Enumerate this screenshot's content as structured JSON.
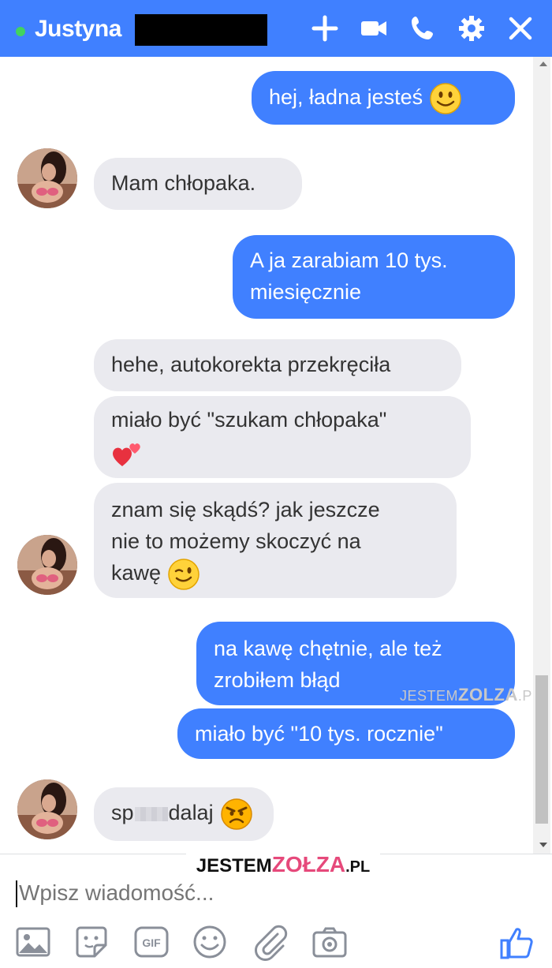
{
  "header": {
    "contact_name": "Justyna",
    "status_color": "#42d35f",
    "icons": [
      "plus-icon",
      "video-camera-icon",
      "phone-icon",
      "gear-icon",
      "close-icon"
    ]
  },
  "messages": [
    {
      "from": "me",
      "text": "hej, ładna jesteś",
      "emoji": "smile-emoji"
    },
    {
      "from": "them",
      "text": "Mam chłopaka."
    },
    {
      "from": "me",
      "lines": [
        "A ja zarabiam 10 tys.",
        "miesięcznie"
      ]
    },
    {
      "from": "them",
      "text": "hehe, autokorekta przekręciła"
    },
    {
      "from": "them",
      "text": "miało być \"szukam chłopaka\"",
      "emoji": "two-hearts-emoji"
    },
    {
      "from": "them",
      "lines": [
        "znam się skądś? jak jeszcze",
        "nie to możemy skoczyć na",
        "kawę"
      ],
      "emoji": "wink-emoji"
    },
    {
      "from": "me",
      "lines": [
        "na kawę chętnie, ale też",
        "zrobiłem błąd"
      ]
    },
    {
      "from": "me",
      "text": "miało być \"10 tys. rocznie\""
    },
    {
      "from": "them",
      "text_start": "sp",
      "text_end": "dalaj",
      "emoji": "angry-emoji"
    }
  ],
  "watermark_small": {
    "prefix": "JESTEM",
    "brand": "ZOLZA",
    "suffix": ".PL"
  },
  "watermark_banner": {
    "prefix": "JESTEM",
    "brand": "ZOŁZA",
    "suffix": ".PL"
  },
  "composer": {
    "placeholder": "Wpisz wiadomość...",
    "tools": [
      "image-icon",
      "sticker-icon",
      "gif-icon",
      "emoji-icon",
      "attachment-icon",
      "camera-icon"
    ],
    "like_icon": "thumbs-up-icon"
  },
  "colors": {
    "accent": "#4080ff",
    "incoming_bubble": "#eaeaef"
  }
}
